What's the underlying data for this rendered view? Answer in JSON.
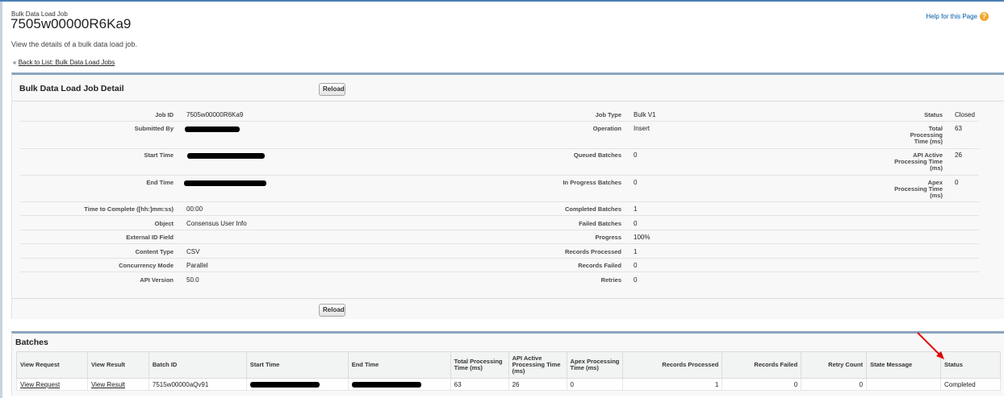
{
  "page": {
    "subtitle": "Bulk Data Load Job",
    "title": "7505w00000R6Ka9",
    "description": "View the details of a bulk data load job.",
    "back_prefix": "«",
    "back_link": "Back to List: Bulk Data Load Jobs",
    "help_link": "Help for this Page",
    "help_icon": "?"
  },
  "detail": {
    "title": "Bulk Data Load Job Detail",
    "reload_label": "Reload",
    "col1": [
      {
        "label": "Job ID",
        "value": "7505w00000R6Ka9"
      },
      {
        "label": "Submitted By",
        "value": ""
      },
      {
        "label": "Start Time",
        "value": ""
      },
      {
        "label": "End Time",
        "value": ""
      },
      {
        "label": "Time to Complete ([hh:]mm:ss)",
        "value": "00:00"
      },
      {
        "label": "Object",
        "value": "Consensus User Info"
      },
      {
        "label": "External ID Field",
        "value": ""
      },
      {
        "label": "Content Type",
        "value": "CSV"
      },
      {
        "label": "Concurrency Mode",
        "value": "Parallel"
      },
      {
        "label": "API Version",
        "value": "50.0"
      }
    ],
    "col2": [
      {
        "label": "Job Type",
        "value": "Bulk V1"
      },
      {
        "label": "Operation",
        "value": "Insert"
      },
      {
        "label": "Queued Batches",
        "value": "0"
      },
      {
        "label": "In Progress Batches",
        "value": "0"
      },
      {
        "label": "Completed Batches",
        "value": "1"
      },
      {
        "label": "Failed Batches",
        "value": "0"
      },
      {
        "label": "Progress",
        "value": "100%"
      },
      {
        "label": "Records Processed",
        "value": "1"
      },
      {
        "label": "Records Failed",
        "value": "0"
      },
      {
        "label": "Retries",
        "value": "0"
      }
    ],
    "col3": [
      {
        "label": "Status",
        "value": "Closed"
      },
      {
        "label": "Total Processing Time (ms)",
        "value": "63"
      },
      {
        "label": "API Active Processing Time (ms)",
        "value": "26"
      },
      {
        "label": "Apex Processing Time (ms)",
        "value": "0"
      }
    ]
  },
  "batches": {
    "title": "Batches",
    "headers": [
      "View Request",
      "View Result",
      "Batch ID",
      "Start Time",
      "End Time",
      "Total Processing Time (ms)",
      "API Active Processing Time (ms)",
      "Apex Processing Time (ms)",
      "Records Processed",
      "Records Failed",
      "Retry Count",
      "State Message",
      "Status"
    ],
    "row": {
      "view_request": "View Request",
      "view_result": "View Result",
      "batch_id": "7515w00000aQv91",
      "total_ms": "63",
      "api_ms": "26",
      "apex_ms": "0",
      "records_processed": "1",
      "records_failed": "0",
      "retry_count": "0",
      "state_message": "",
      "status": "Completed"
    }
  },
  "colors": {
    "block_border": "#8ba4be",
    "help_link": "#015ba7",
    "help_icon": "#f3a72b",
    "annotation_arrow": "#e00000"
  }
}
